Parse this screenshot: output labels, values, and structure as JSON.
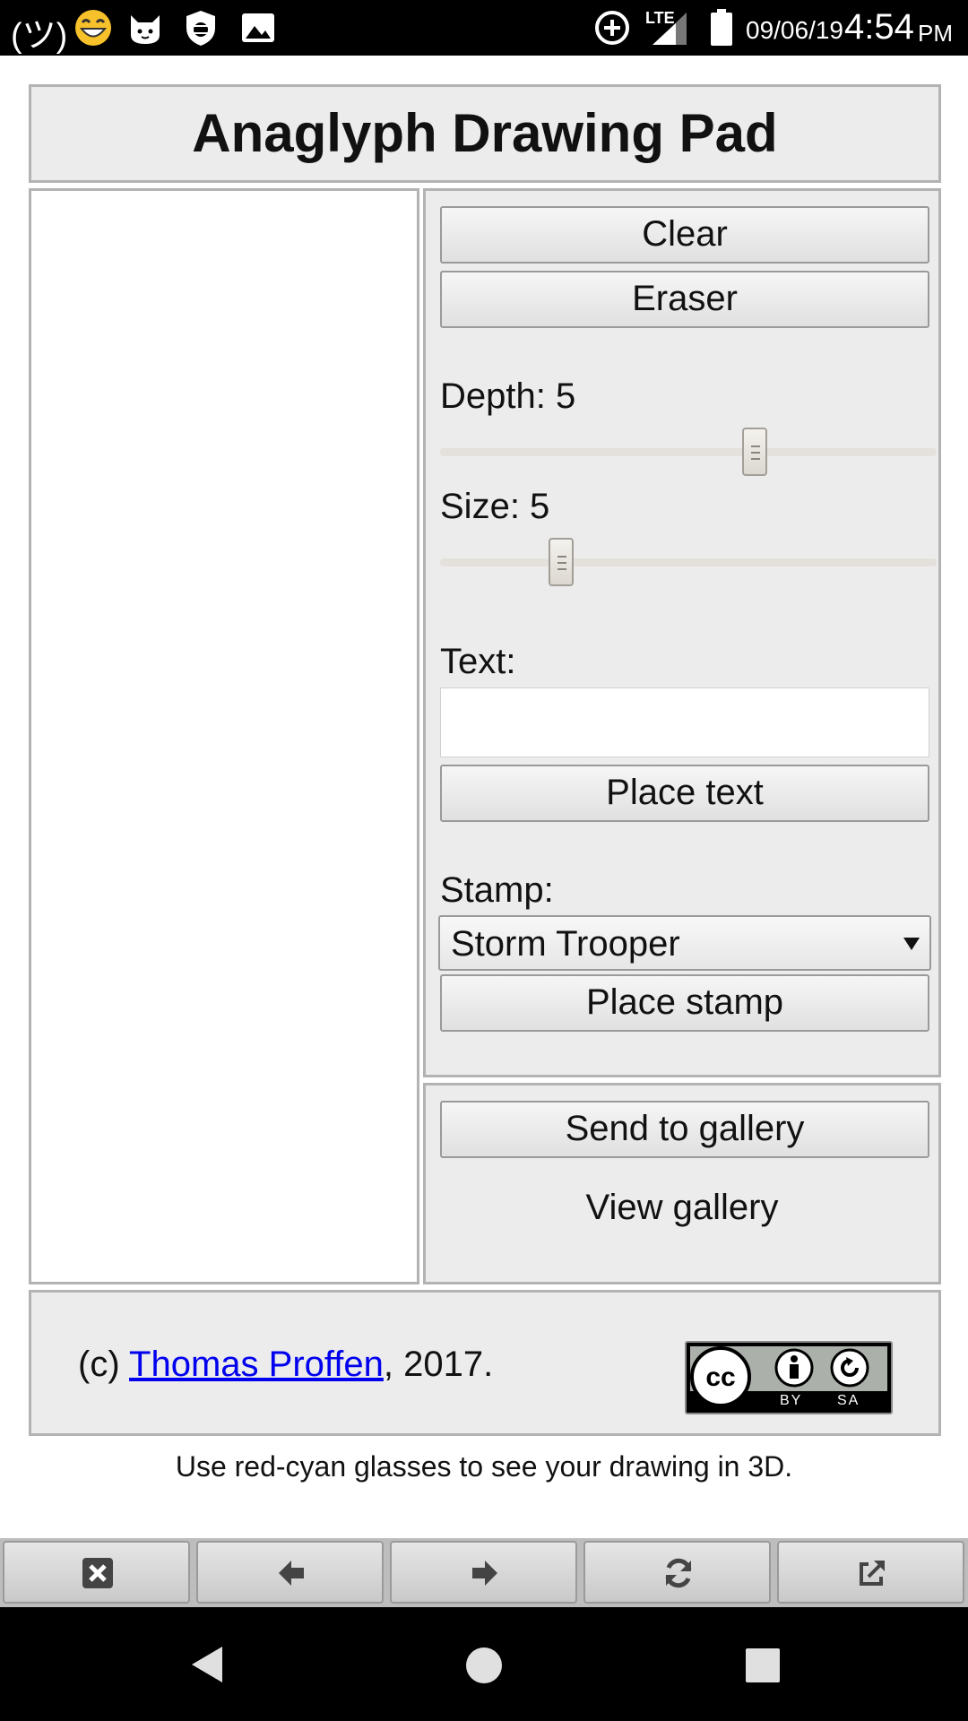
{
  "status_bar": {
    "left_text": "(ツ)",
    "network": "LTE",
    "date": "09/06/19",
    "time": "4:54",
    "ampm": "PM"
  },
  "app": {
    "title": "Anaglyph Drawing Pad"
  },
  "controls": {
    "clear_label": "Clear",
    "eraser_label": "Eraser",
    "depth_label": "Depth: 5",
    "depth_value_fraction": 0.64,
    "size_label": "Size: 5",
    "size_value_fraction": 0.23,
    "text_label": "Text:",
    "text_value": "",
    "place_text_label": "Place text",
    "stamp_label": "Stamp:",
    "stamp_selected": "Storm Trooper",
    "place_stamp_label": "Place stamp"
  },
  "gallery": {
    "send_label": "Send to gallery",
    "view_label": "View gallery"
  },
  "footer": {
    "prefix": "(c) ",
    "author_link": "Thomas Proffen",
    "suffix": ", 2017.",
    "license_badge": {
      "icon": "cc-by-sa-icon",
      "left": "BY",
      "right": "SA"
    },
    "note": "Use red-cyan glasses to see your drawing in 3D."
  },
  "browser_toolbar": {
    "icons": [
      "close-icon",
      "arrow-left-icon",
      "arrow-right-icon",
      "refresh-icon",
      "external-link-icon"
    ]
  },
  "colors": {
    "panel_bg": "#ececec",
    "link": "#0000ee"
  }
}
